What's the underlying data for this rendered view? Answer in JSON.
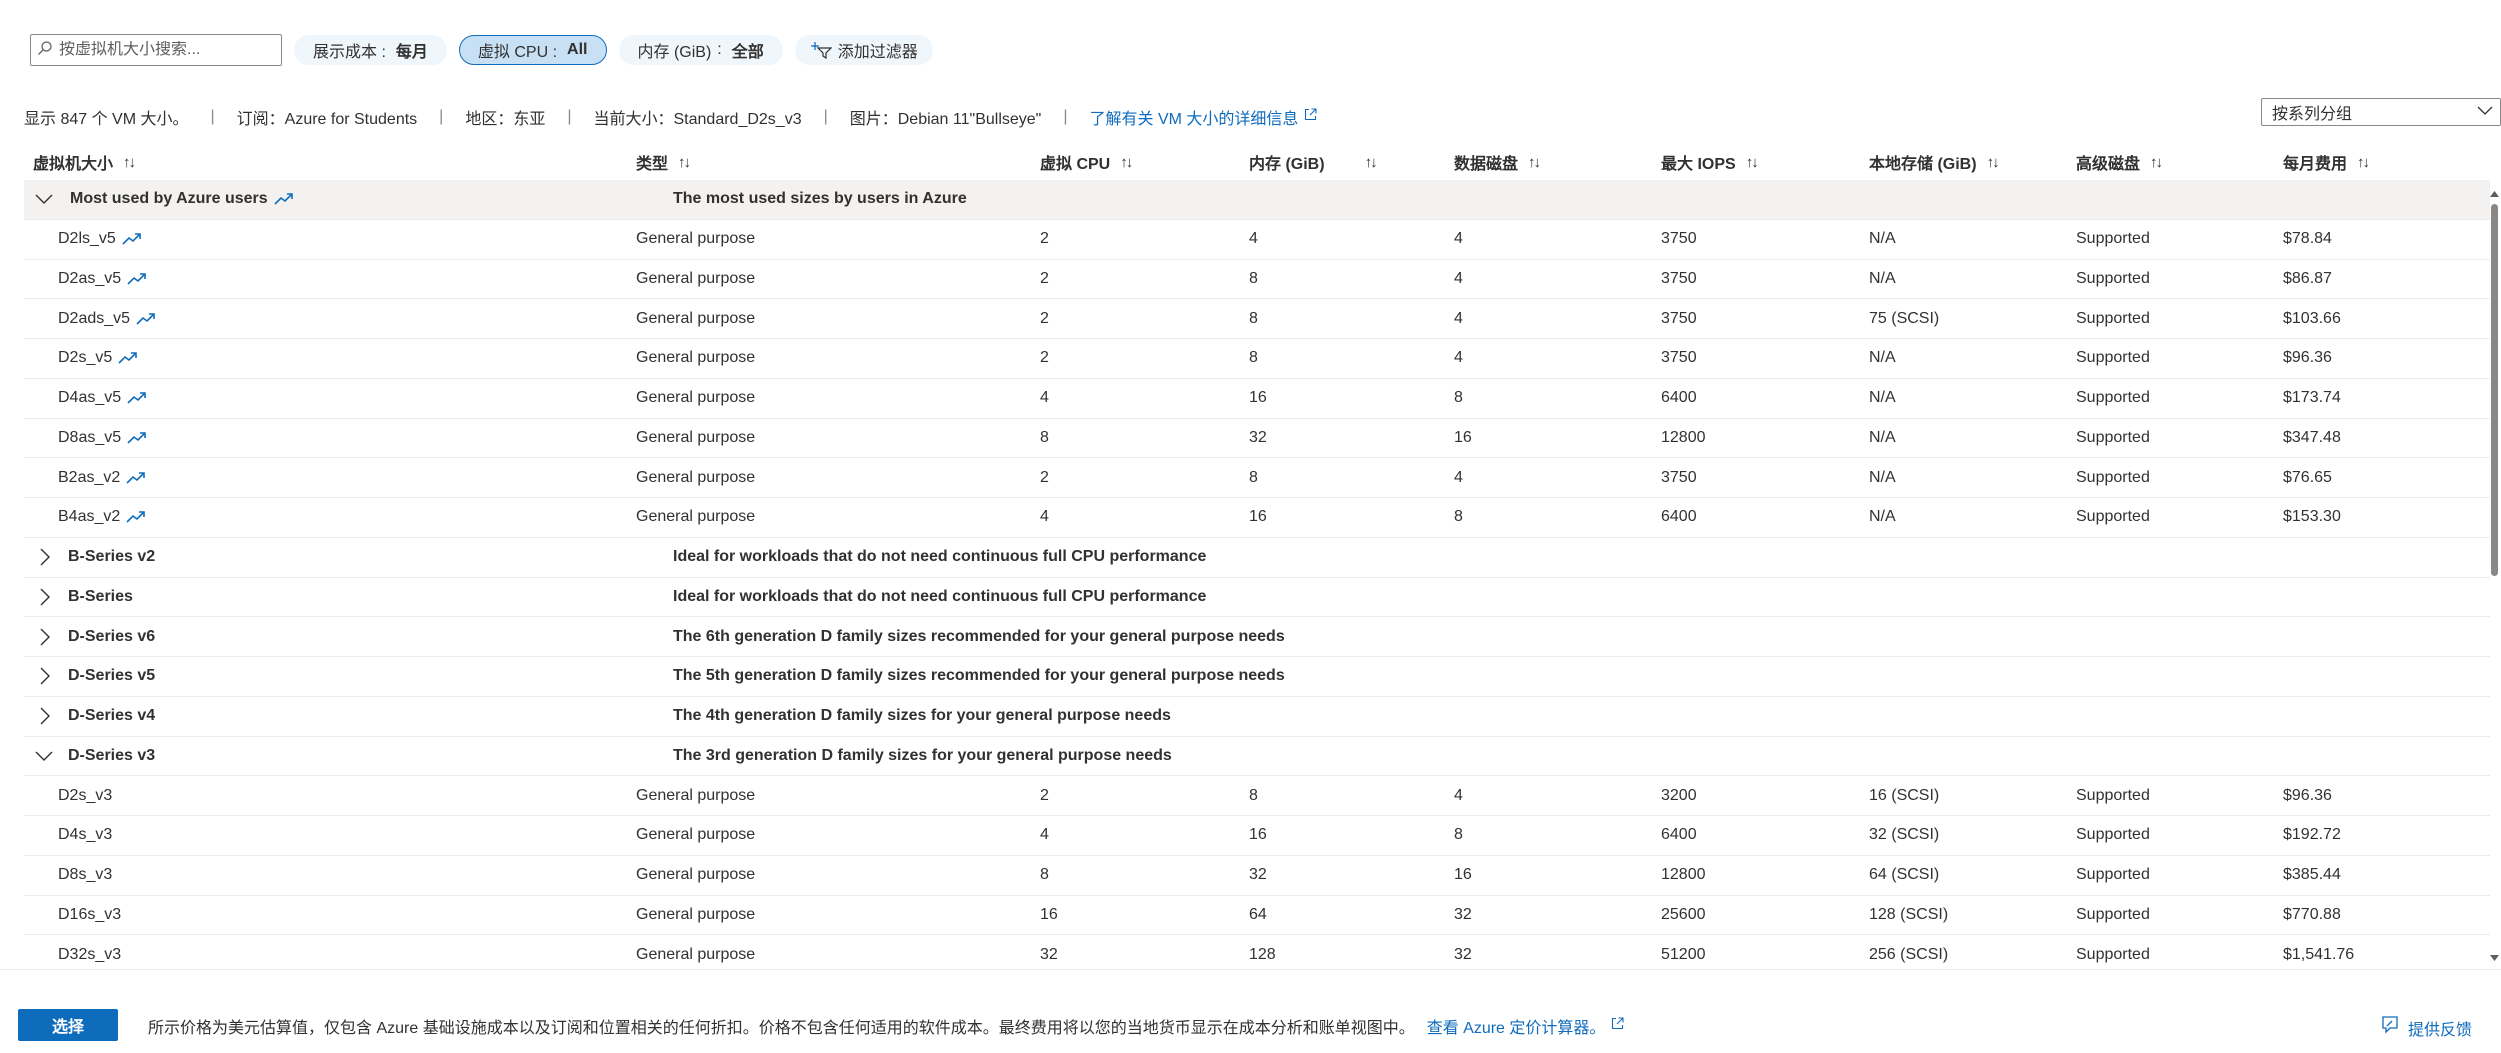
{
  "filters": {
    "search_placeholder": "按虚拟机大小搜索...",
    "cost": {
      "label": "展示成本 :",
      "value": "每月"
    },
    "vcpu": {
      "label": "虚拟 CPU :",
      "value": "All"
    },
    "memory": {
      "label": "内存 (GiB)",
      "sep": ":",
      "value": "全部"
    },
    "add_filter": "添加过滤器"
  },
  "info": {
    "count": "显示 847 个 VM 大小。",
    "subscription": "订阅：Azure for Students",
    "region": "地区：东亚",
    "current_size": "当前大小：Standard_D2s_v3",
    "image": "图片：Debian 11\"Bullseye\"",
    "learn_more": "了解有关 VM 大小的详细信息"
  },
  "group_by": "按系列分组",
  "columns": [
    "虚拟机大小",
    "类型",
    "虚拟 CPU",
    "内存 (GiB)",
    "数据磁盘",
    "最大 IOPS",
    "本地存储 (GiB)",
    "高级磁盘",
    "每月费用"
  ],
  "rows": [
    {
      "kind": "group",
      "expanded": true,
      "name": "Most used by Azure users",
      "trend": true,
      "desc": "The most used sizes by users in Azure"
    },
    {
      "kind": "item",
      "trend": true,
      "cells": [
        "D2ls_v5",
        "General purpose",
        "2",
        "4",
        "4",
        "3750",
        "N/A",
        "Supported",
        "$78.84"
      ]
    },
    {
      "kind": "item",
      "trend": true,
      "cells": [
        "D2as_v5",
        "General purpose",
        "2",
        "8",
        "4",
        "3750",
        "N/A",
        "Supported",
        "$86.87"
      ]
    },
    {
      "kind": "item",
      "trend": true,
      "cells": [
        "D2ads_v5",
        "General purpose",
        "2",
        "8",
        "4",
        "3750",
        "75 (SCSI)",
        "Supported",
        "$103.66"
      ]
    },
    {
      "kind": "item",
      "trend": true,
      "cells": [
        "D2s_v5",
        "General purpose",
        "2",
        "8",
        "4",
        "3750",
        "N/A",
        "Supported",
        "$96.36"
      ]
    },
    {
      "kind": "item",
      "trend": true,
      "cells": [
        "D4as_v5",
        "General purpose",
        "4",
        "16",
        "8",
        "6400",
        "N/A",
        "Supported",
        "$173.74"
      ]
    },
    {
      "kind": "item",
      "trend": true,
      "cells": [
        "D8as_v5",
        "General purpose",
        "8",
        "32",
        "16",
        "12800",
        "N/A",
        "Supported",
        "$347.48"
      ]
    },
    {
      "kind": "item",
      "trend": true,
      "cells": [
        "B2as_v2",
        "General purpose",
        "2",
        "8",
        "4",
        "3750",
        "N/A",
        "Supported",
        "$76.65"
      ]
    },
    {
      "kind": "item",
      "trend": true,
      "cells": [
        "B4as_v2",
        "General purpose",
        "4",
        "16",
        "8",
        "6400",
        "N/A",
        "Supported",
        "$153.30"
      ]
    },
    {
      "kind": "group",
      "expanded": false,
      "name": "B-Series v2",
      "desc": "Ideal for workloads that do not need continuous full CPU performance"
    },
    {
      "kind": "group",
      "expanded": false,
      "name": "B-Series",
      "desc": "Ideal for workloads that do not need continuous full CPU performance"
    },
    {
      "kind": "group",
      "expanded": false,
      "name": "D-Series v6",
      "desc": "The 6th generation D family sizes recommended for your general purpose needs"
    },
    {
      "kind": "group",
      "expanded": false,
      "name": "D-Series v5",
      "desc": "The 5th generation D family sizes recommended for your general purpose needs"
    },
    {
      "kind": "group",
      "expanded": false,
      "name": "D-Series v4",
      "desc": "The 4th generation D family sizes for your general purpose needs"
    },
    {
      "kind": "group",
      "expanded": true,
      "name": "D-Series v3",
      "desc": "The 3rd generation D family sizes for your general purpose needs"
    },
    {
      "kind": "item",
      "trend": false,
      "cells": [
        "D2s_v3",
        "General purpose",
        "2",
        "8",
        "4",
        "3200",
        "16 (SCSI)",
        "Supported",
        "$96.36"
      ]
    },
    {
      "kind": "item",
      "trend": false,
      "cells": [
        "D4s_v3",
        "General purpose",
        "4",
        "16",
        "8",
        "6400",
        "32 (SCSI)",
        "Supported",
        "$192.72"
      ]
    },
    {
      "kind": "item",
      "trend": false,
      "cells": [
        "D8s_v3",
        "General purpose",
        "8",
        "32",
        "16",
        "12800",
        "64 (SCSI)",
        "Supported",
        "$385.44"
      ]
    },
    {
      "kind": "item",
      "trend": false,
      "cells": [
        "D16s_v3",
        "General purpose",
        "16",
        "64",
        "32",
        "25600",
        "128 (SCSI)",
        "Supported",
        "$770.88"
      ]
    },
    {
      "kind": "item",
      "trend": false,
      "cells": [
        "D32s_v3",
        "General purpose",
        "32",
        "128",
        "32",
        "51200",
        "256 (SCSI)",
        "Supported",
        "$1,541.76"
      ]
    }
  ],
  "footer": {
    "select": "选择",
    "note": "所示价格为美元估算值，仅包含 Azure 基础设施成本以及订阅和位置相关的任何折扣。价格不包含任何适用的软件成本。最终费用将以您的当地货币显示在成本分析和账单视图中。",
    "calculator": "查看 Azure 定价计算器。",
    "feedback": "提供反馈"
  },
  "colors": {
    "accent": "#0f6cbd",
    "group_bg": "#f3f2f1",
    "pill_bg": "#eff6fc",
    "pill_active": "#c7e0f4"
  }
}
